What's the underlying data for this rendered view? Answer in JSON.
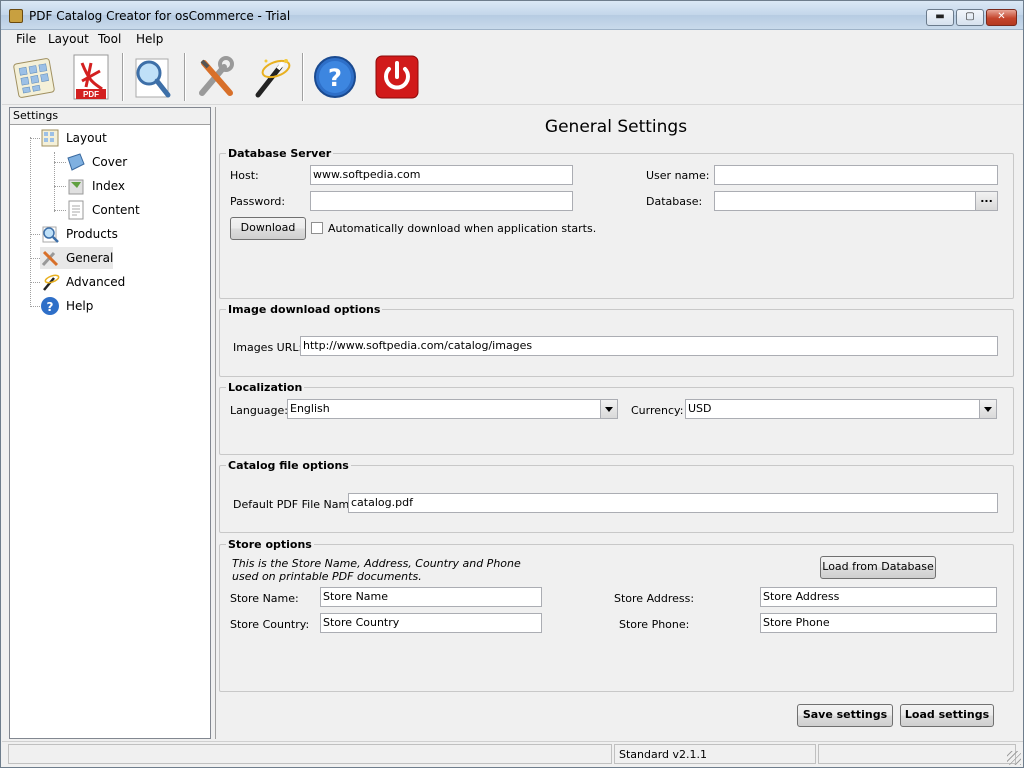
{
  "window": {
    "title": "PDF Catalog Creator for osCommerce - Trial",
    "min": "▬",
    "max": "▢",
    "close": "✕"
  },
  "menu": [
    "File",
    "Layout",
    "Tool",
    "Help"
  ],
  "toolbar": [
    "catalog-icon",
    "pdf-icon",
    "preview-icon",
    "tools-icon",
    "wand-icon",
    "help-icon",
    "power-icon"
  ],
  "toolbar_pdf_text": "PDF",
  "sidebar": {
    "header": "Settings",
    "items": [
      {
        "label": "Layout",
        "icon": "layout-icon"
      },
      {
        "label": "Cover",
        "icon": "cover-icon"
      },
      {
        "label": "Index",
        "icon": "index-icon"
      },
      {
        "label": "Content",
        "icon": "content-icon"
      },
      {
        "label": "Products",
        "icon": "products-icon"
      },
      {
        "label": "General",
        "icon": "general-icon"
      },
      {
        "label": "Advanced",
        "icon": "advanced-icon"
      },
      {
        "label": "Help",
        "icon": "help-icon"
      }
    ],
    "help_glyph": "?"
  },
  "main": {
    "title": "General Settings",
    "db": {
      "legend": "Database Server",
      "host_label": "Host:",
      "host_value": "www.softpedia.com",
      "password_label": "Password:",
      "password_value": "",
      "user_label": "User name:",
      "user_value": "",
      "database_label": "Database:",
      "database_value": "",
      "browse": "...",
      "download_button": "Download",
      "auto_download_label": "Automatically download when application starts."
    },
    "images": {
      "legend": "Image download options",
      "url_label": "Images URL:",
      "url_value": "http://www.softpedia.com/catalog/images"
    },
    "localization": {
      "legend": "Localization",
      "language_label": "Language:",
      "language_value": "English",
      "currency_label": "Currency:",
      "currency_value": "USD"
    },
    "catalog": {
      "legend": "Catalog file options",
      "pdf_name_label": "Default PDF File Name:",
      "pdf_name_value": "catalog.pdf"
    },
    "store": {
      "legend": "Store options",
      "note_line1": "This is the Store Name, Address, Country and Phone",
      "note_line2": "used on printable PDF documents.",
      "load_db_button": "Load from Database",
      "name_label": "Store Name:",
      "name_value": "Store Name",
      "address_label": "Store Address:",
      "address_value": "Store Address",
      "country_label": "Store Country:",
      "country_value": "Store Country",
      "phone_label": "Store Phone:",
      "phone_value": "Store Phone"
    },
    "save_button": "Save settings",
    "load_button": "Load settings"
  },
  "status": {
    "left": "",
    "version": "Standard v2.1.1",
    "right": ""
  }
}
